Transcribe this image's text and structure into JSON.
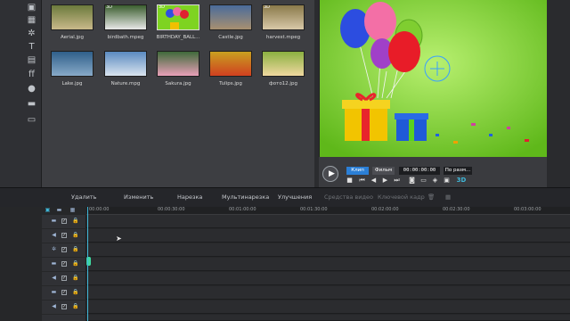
{
  "library": {
    "thumbnails": [
      {
        "label": "Aerial.jpg",
        "badge": "",
        "colors": [
          "#6b7a3c",
          "#c9b98a"
        ]
      },
      {
        "label": "birdbath.mpeg",
        "badge": "3D",
        "colors": [
          "#3b5e2f",
          "#e8e8e8"
        ]
      },
      {
        "label": "BIRTHDAY_BALL...",
        "badge": "3D",
        "colors": [
          "#7ed321",
          "#e64a8a"
        ]
      },
      {
        "label": "Castle.jpg",
        "badge": "",
        "colors": [
          "#4a6b9b",
          "#a89070"
        ]
      },
      {
        "label": "harvest.mpeg",
        "badge": "3D",
        "colors": [
          "#8a7a4a",
          "#d8c8a8"
        ]
      },
      {
        "label": "Lake.jpg",
        "badge": "",
        "colors": [
          "#2f5f8a",
          "#88aac8"
        ]
      },
      {
        "label": "Nature.mpg",
        "badge": "",
        "colors": [
          "#5a8ac0",
          "#d9e4ef"
        ]
      },
      {
        "label": "Sakura.jpg",
        "badge": "",
        "colors": [
          "#3f6a3a",
          "#e8a0b8"
        ]
      },
      {
        "label": "Tulips.jpg",
        "badge": "",
        "colors": [
          "#c8a020",
          "#d04020"
        ]
      },
      {
        "label": "фото12.jpg",
        "badge": "",
        "colors": [
          "#8ab040",
          "#f0d8a0"
        ]
      }
    ]
  },
  "player": {
    "tab_clip": "Клип",
    "tab_movie": "Фильм",
    "timecode": "00:00:00:00",
    "fit_label": "По разм...",
    "mode_3d": "3D"
  },
  "edit_tabs": [
    "Удалить",
    "Изменить",
    "Нарезка",
    "Мультинарезка",
    "Улучшения",
    "Средства видео",
    "Ключевой кадр"
  ],
  "timeline": {
    "ruler_labels": [
      "00:00:00",
      "00:00:30:00",
      "00:01:00:00",
      "00:01:30:00",
      "00:02:00:00",
      "00:02:30:00",
      "00:03:00:00"
    ]
  },
  "colors": {
    "accent": "#3fb7d8",
    "preview_bg": "#7ed321",
    "clip_tab_active": "#2b7fd6"
  }
}
